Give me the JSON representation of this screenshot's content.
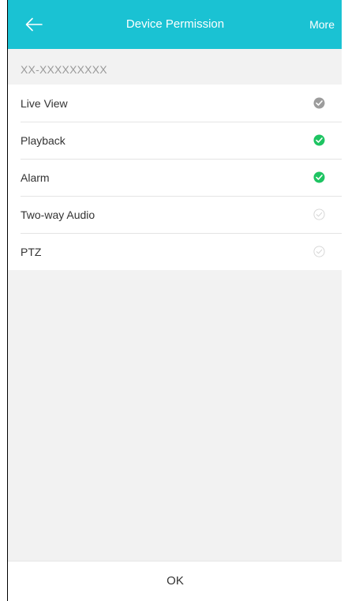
{
  "header": {
    "title": "Device Permission",
    "more_label": "More",
    "back_icon": "arrow-left-icon",
    "background": "#1ac2d3"
  },
  "device": {
    "id": "XX-XXXXXXXXX"
  },
  "permissions": [
    {
      "label": "Live View",
      "state": "checked-gray",
      "icon": "check-circle-icon"
    },
    {
      "label": "Playback",
      "state": "checked",
      "icon": "check-circle-icon"
    },
    {
      "label": "Alarm",
      "state": "checked",
      "icon": "check-circle-icon"
    },
    {
      "label": "Two-way Audio",
      "state": "unchecked",
      "icon": "check-outline-icon"
    },
    {
      "label": "PTZ",
      "state": "unchecked",
      "icon": "check-outline-icon"
    }
  ],
  "colors": {
    "checked": "#1ec462",
    "checked_gray": "#9c9c9c",
    "unchecked": "#d4d4d4"
  },
  "footer": {
    "ok_label": "OK"
  }
}
